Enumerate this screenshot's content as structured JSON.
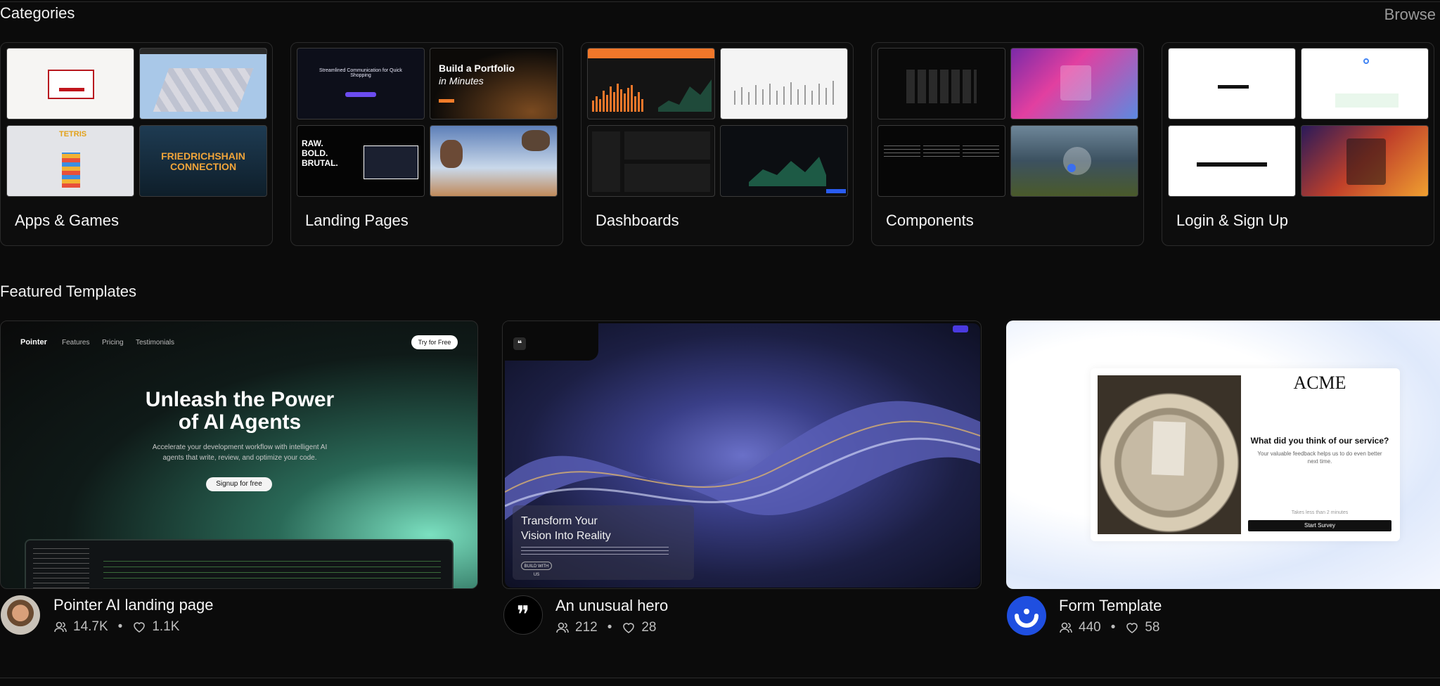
{
  "categories": {
    "title": "Categories",
    "browse": "Browse",
    "items": [
      {
        "label": "Apps & Games"
      },
      {
        "label": "Landing Pages"
      },
      {
        "label": "Dashboards"
      },
      {
        "label": "Components"
      },
      {
        "label": "Login & Sign Up"
      }
    ],
    "thumb_text": {
      "friedrichshain": "FRIEDRICHSHAIN CONNECTION",
      "tetris": "TETRIS",
      "portfolio_line1": "Build a Portfolio",
      "portfolio_line2": "in Minutes",
      "raw_bold": "RAW. BOLD. BRUTAL.",
      "streamlined": "Streamlined Communication for Quick Shopping"
    }
  },
  "featured": {
    "title": "Featured Templates",
    "items": [
      {
        "title": "Pointer AI landing page",
        "users": "14.7K",
        "likes": "1.1K",
        "preview": {
          "brand": "Pointer",
          "nav": [
            "Features",
            "Pricing",
            "Testimonials"
          ],
          "cta": "Try for Free",
          "headline1": "Unleash the Power",
          "headline2": "of AI Agents",
          "sub1": "Accelerate your development workflow with intelligent AI",
          "sub2": "agents that write, review, and optimize your code.",
          "button": "Signup for free"
        }
      },
      {
        "title": "An unusual hero",
        "users": "212",
        "likes": "28",
        "preview": {
          "headline1": "Transform Your",
          "headline2": "Vision Into Reality",
          "button": "BUILD WITH US"
        }
      },
      {
        "title": "Form Template",
        "users": "440",
        "likes": "58",
        "preview": {
          "brand": "ACME",
          "question": "What did you think of our service?",
          "sub": "Your valuable feedback helps us to do even better next time.",
          "note": "Takes less than 2 minutes",
          "button": "Start Survey"
        }
      }
    ]
  },
  "colors": {
    "background": "#0b0b0b",
    "accent_blue": "#1f4fe0",
    "dashboard_orange": "#f0772a"
  }
}
